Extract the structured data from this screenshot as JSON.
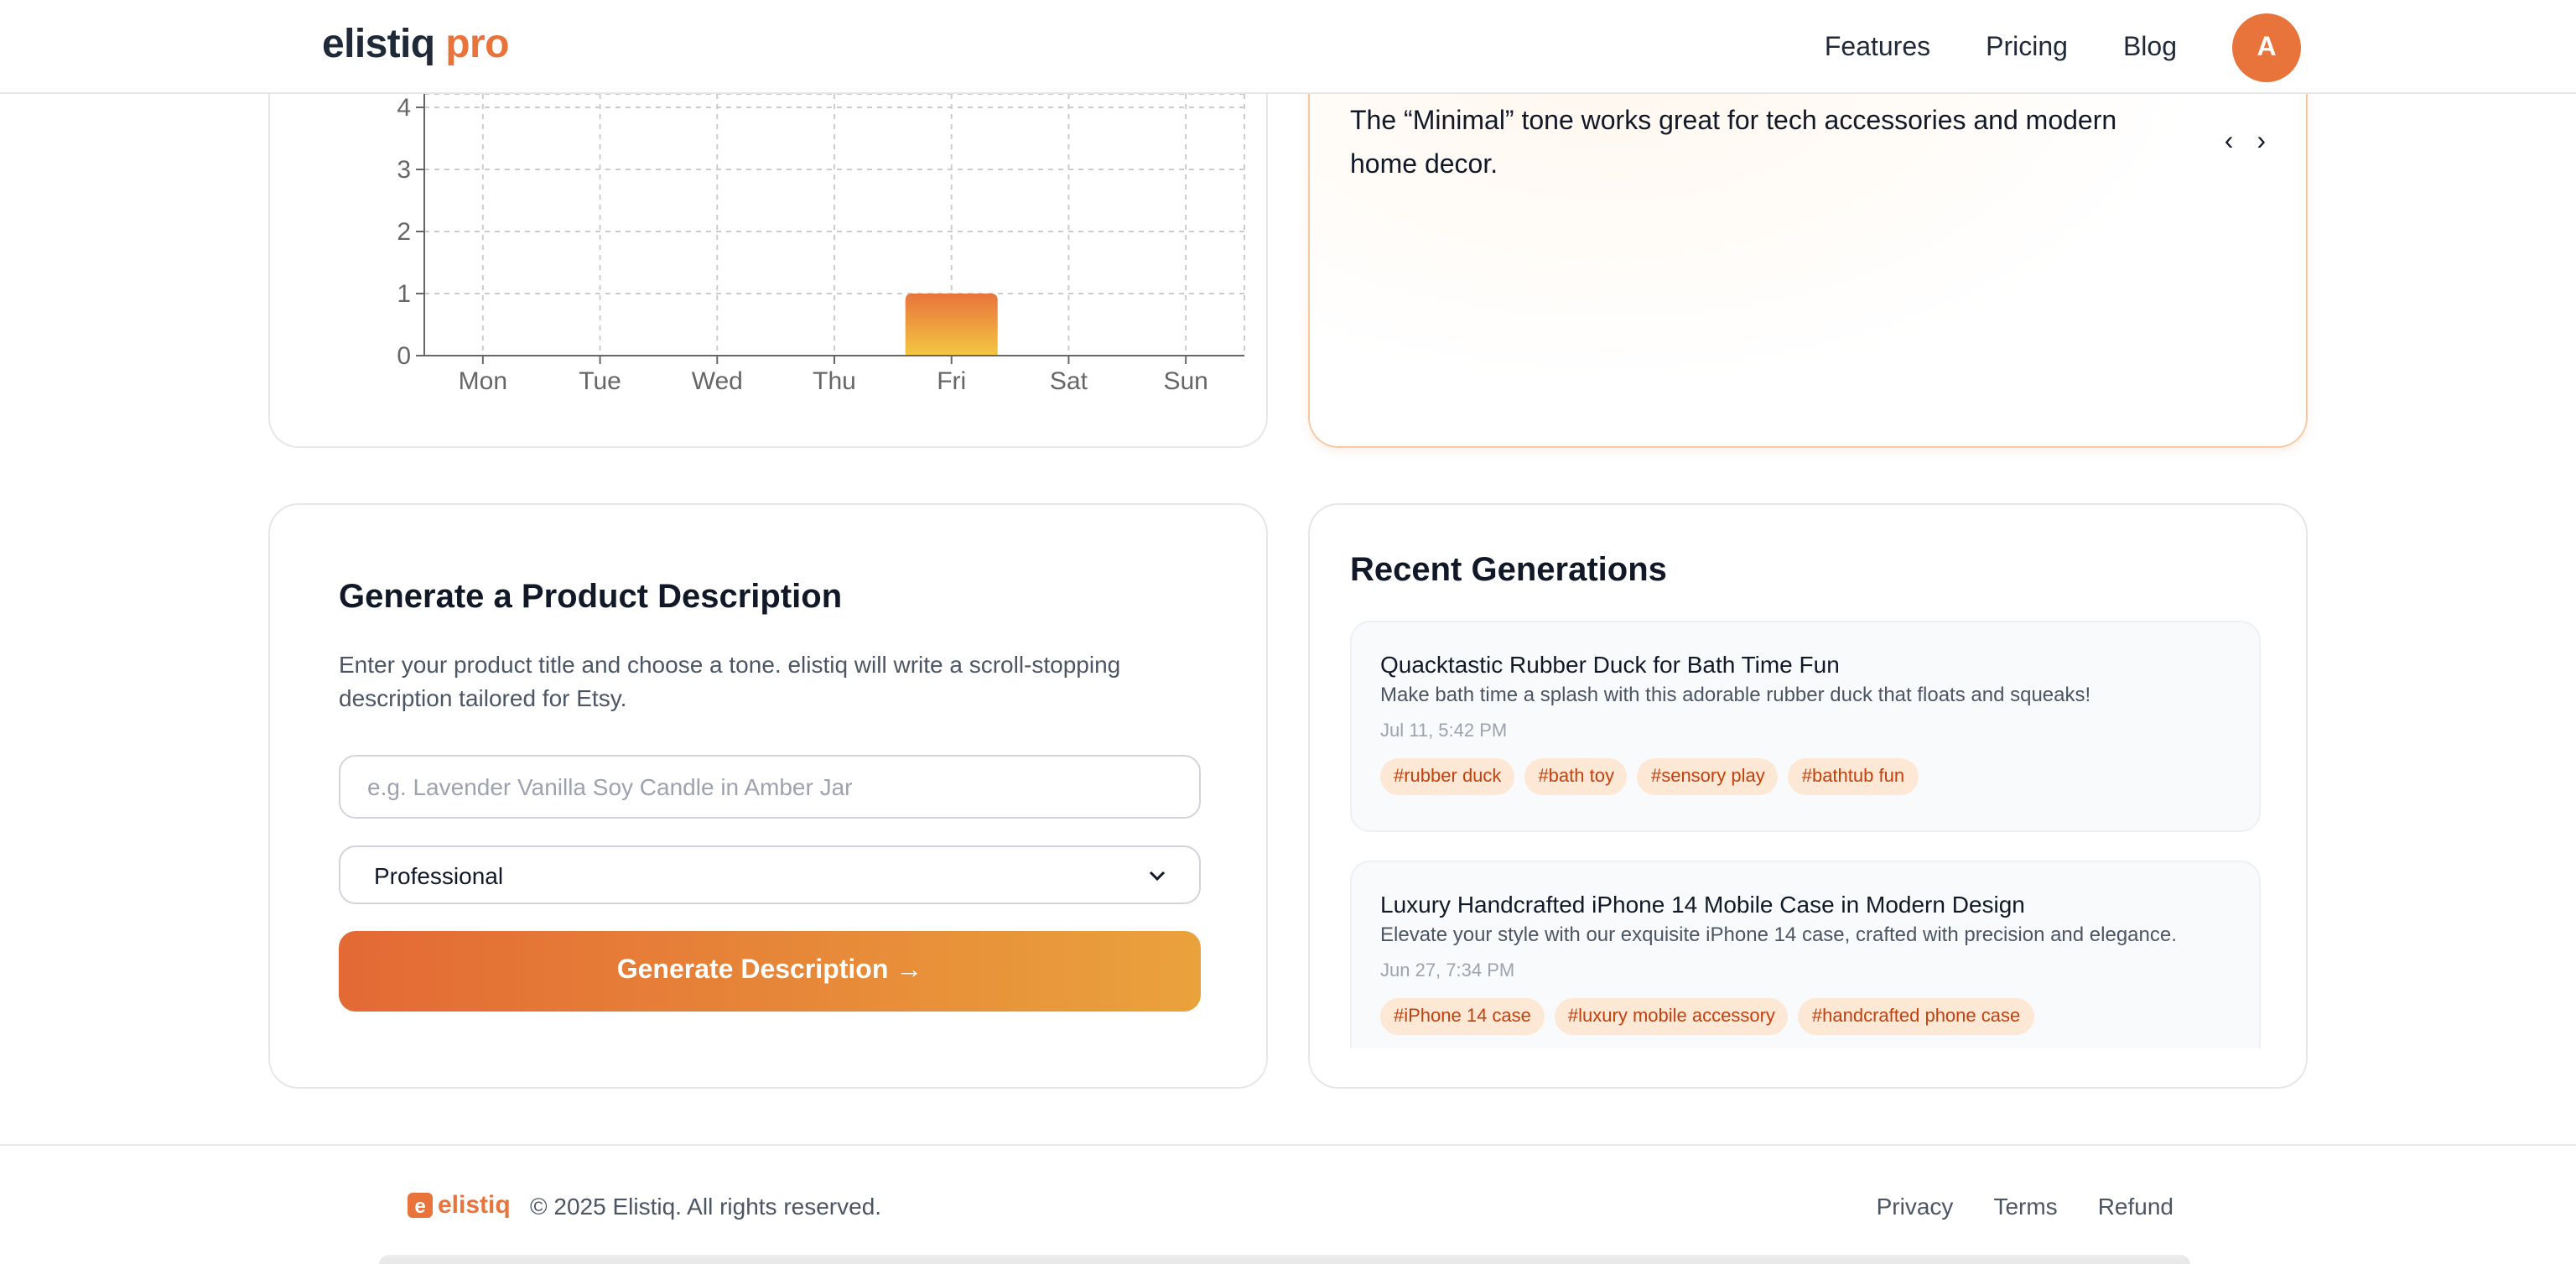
{
  "header": {
    "logo_main": "elistiq",
    "logo_accent": "pro",
    "nav": [
      "Features",
      "Pricing",
      "Blog"
    ],
    "avatar_initial": "A"
  },
  "chart_data": {
    "type": "bar",
    "categories": [
      "Mon",
      "Tue",
      "Wed",
      "Thu",
      "Fri",
      "Sat",
      "Sun"
    ],
    "values": [
      0,
      0,
      0,
      0,
      1,
      0,
      0
    ],
    "y_ticks": [
      "0",
      "1",
      "2",
      "3",
      "4"
    ],
    "ylim": [
      0,
      4
    ],
    "grid": true,
    "bar_gradient": [
      "#e8743b",
      "#f4c743"
    ]
  },
  "tip": {
    "text": "The “Minimal” tone works great for tech accessories and modern home decor.",
    "prev_icon": "‹",
    "next_icon": "›"
  },
  "generator": {
    "title": "Generate a Product Description",
    "description": "Enter your product title and choose a tone. elistiq will write a scroll-stopping description tailored for Etsy.",
    "placeholder": "e.g. Lavender Vanilla Soy Candle in Amber Jar",
    "tone_selected": "Professional",
    "button_label": "Generate Description →"
  },
  "recent": {
    "title": "Recent Generations",
    "items": [
      {
        "title": "Quacktastic Rubber Duck for Bath Time Fun",
        "desc": "Make bath time a splash with this adorable rubber duck that floats and squeaks!",
        "time": "Jul 11, 5:42 PM",
        "tags": [
          "#rubber duck",
          "#bath toy",
          "#sensory play",
          "#bathtub fun"
        ]
      },
      {
        "title": "Luxury Handcrafted iPhone 14 Mobile Case in Modern Design",
        "desc": "Elevate your style with our exquisite iPhone 14 case, crafted with precision and elegance.",
        "time": "Jun 27, 7:34 PM",
        "tags": [
          "#iPhone 14 case",
          "#luxury mobile accessory",
          "#handcrafted phone case"
        ]
      }
    ]
  },
  "footer": {
    "logo_badge": "e",
    "logo_text": "elistiq",
    "copyright": "© 2025 Elistiq. All rights reserved.",
    "links": [
      "Privacy",
      "Terms",
      "Refund"
    ]
  }
}
